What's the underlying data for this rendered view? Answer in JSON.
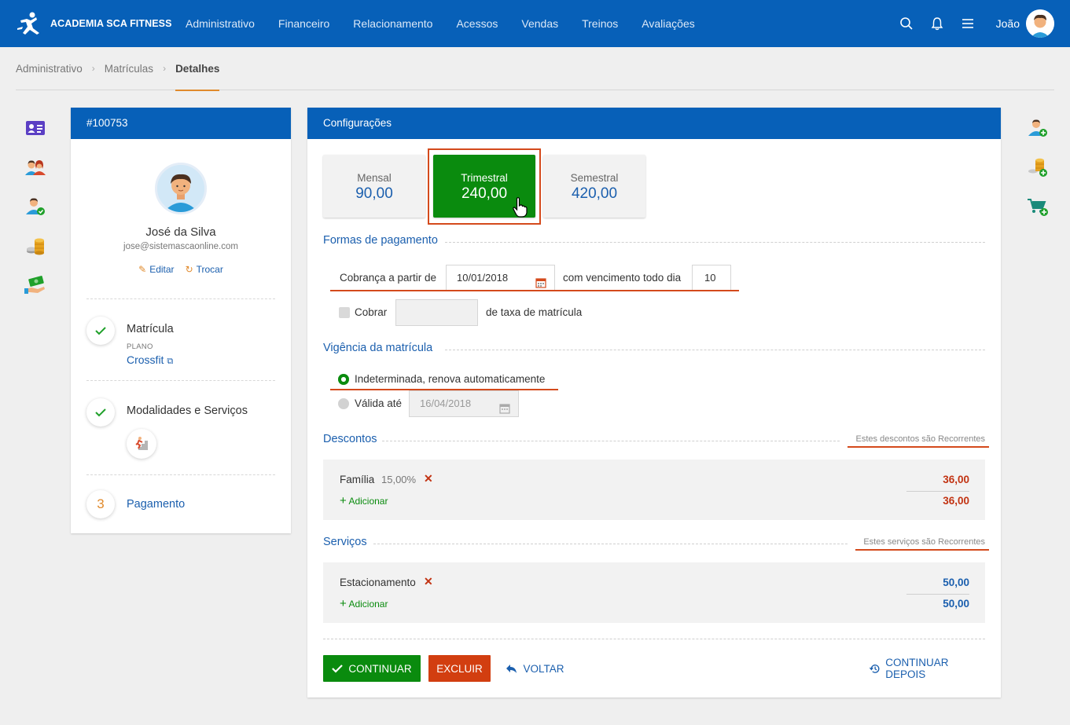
{
  "app": {
    "title": "ACADEMIA SCA FITNESS"
  },
  "nav": [
    "Administrativo",
    "Financeiro",
    "Relacionamento",
    "Acessos",
    "Vendas",
    "Treinos",
    "Avaliações"
  ],
  "user": {
    "name": "João"
  },
  "breadcrumb": [
    "Administrativo",
    "Matrículas",
    "Detalhes"
  ],
  "colors": {
    "primary": "#0760b8",
    "success": "#0a8b0e",
    "danger": "#d23e10",
    "accent": "#e08a2c"
  },
  "left_rail_icons": [
    "id-card-icon",
    "people-icon",
    "user-check-icon",
    "coins-icon",
    "money-hand-icon"
  ],
  "right_rail_icons": [
    "add-user-icon",
    "add-coins-icon",
    "add-cart-icon"
  ],
  "profile_panel": {
    "id": "#100753",
    "name": "José da Silva",
    "email": "jose@sistemascaonline.com",
    "edit_label": "Editar",
    "swap_label": "Trocar",
    "steps": [
      {
        "title": "Matrícula",
        "sub": "PLANO",
        "link": "Crossfit",
        "done": true
      },
      {
        "title": "Modalidades e Serviços",
        "done": true
      },
      {
        "number": "3",
        "title": "Pagamento",
        "done": false
      }
    ]
  },
  "config": {
    "title": "Configurações",
    "plans": [
      {
        "label": "Mensal",
        "value": "90,00",
        "selected": false
      },
      {
        "label": "Trimestral",
        "value": "240,00",
        "selected": true
      },
      {
        "label": "Semestral",
        "value": "420,00",
        "selected": false
      }
    ],
    "payment": {
      "title": "Formas de pagamento",
      "start_label": "Cobrança a partir de",
      "start_date": "10/01/2018",
      "due_label": "com vencimento todo dia",
      "due_day": "10",
      "fee_checkbox_label": "Cobrar",
      "fee_suffix": "de taxa de matrícula"
    },
    "validity": {
      "title": "Vigência da matrícula",
      "option_indefinite": "Indeterminada, renova automaticamente",
      "option_until": "Válida até",
      "until_date": "16/04/2018"
    },
    "discounts": {
      "title": "Descontos",
      "recurring_note": "Estes descontos são Recorrentes",
      "items": [
        {
          "name": "Família",
          "percent": "15,00%",
          "value": "36,00"
        }
      ],
      "add_label": "Adicionar",
      "total": "36,00"
    },
    "services": {
      "title": "Serviços",
      "recurring_note": "Estes serviços são Recorrentes",
      "items": [
        {
          "name": "Estacionamento",
          "value": "50,00"
        }
      ],
      "add_label": "Adicionar",
      "total": "50,00"
    },
    "actions": {
      "continue": "CONTINUAR",
      "delete": "EXCLUIR",
      "back": "VOLTAR",
      "continue_later": "CONTINUAR DEPOIS"
    }
  }
}
